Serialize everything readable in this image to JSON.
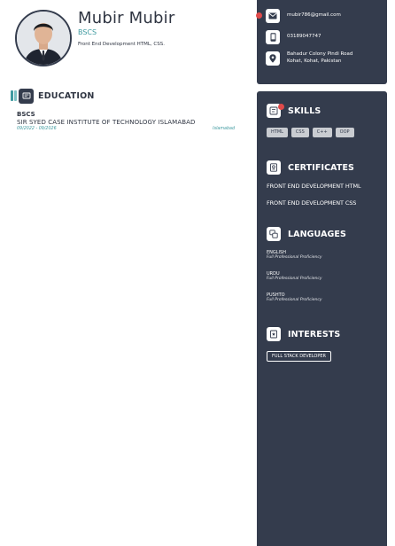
{
  "profile": {
    "name": "Mubir Mubir",
    "degree": "BSCS",
    "summary": "Front End Development HTML, CSS."
  },
  "education": {
    "title": "EDUCATION",
    "items": [
      {
        "degree": "BSCS",
        "school": "SIR SYED CASE INSTITUTE OF TECHNOLOGY ISLAMABAD",
        "dates": "09/2022 - 09/2026",
        "location": "Islamabad"
      }
    ]
  },
  "contact": {
    "email": "mubir786@gmail.com",
    "phone": "03189047747",
    "address_line1": "Bahadur Colony Pindi Road",
    "address_line2": "Kohat, Kohat, Pakistan"
  },
  "skills": {
    "title": "SKILLS",
    "items": [
      "HTML",
      "CSS",
      "C++",
      "OOP"
    ]
  },
  "certificates": {
    "title": "CERTIFICATES",
    "items": [
      "FRONT END DEVELOPMENT HTML",
      "FRONT END DEVELOPMENT CSS"
    ]
  },
  "languages": {
    "title": "LANGUAGES",
    "items": [
      {
        "name": "ENGLISH",
        "level": "Full Professional Proficiency"
      },
      {
        "name": "URDU",
        "level": "Full Professional Proficiency"
      },
      {
        "name": "PUSHTO",
        "level": "Full Professional Proficiency"
      }
    ]
  },
  "interests": {
    "title": "INTERESTS",
    "items": [
      "FULL STACK DEVELOPER"
    ]
  },
  "colors": {
    "panel": "#343c4d",
    "accent": "#3f9aa0",
    "badge": "#e04a4a"
  },
  "icons": {
    "email": "envelope-icon",
    "phone": "phone-icon",
    "address": "location-pin-icon",
    "education": "graduation-icon",
    "skills": "skills-icon",
    "certificates": "certificate-icon",
    "languages": "language-icon",
    "interests": "interest-icon"
  }
}
